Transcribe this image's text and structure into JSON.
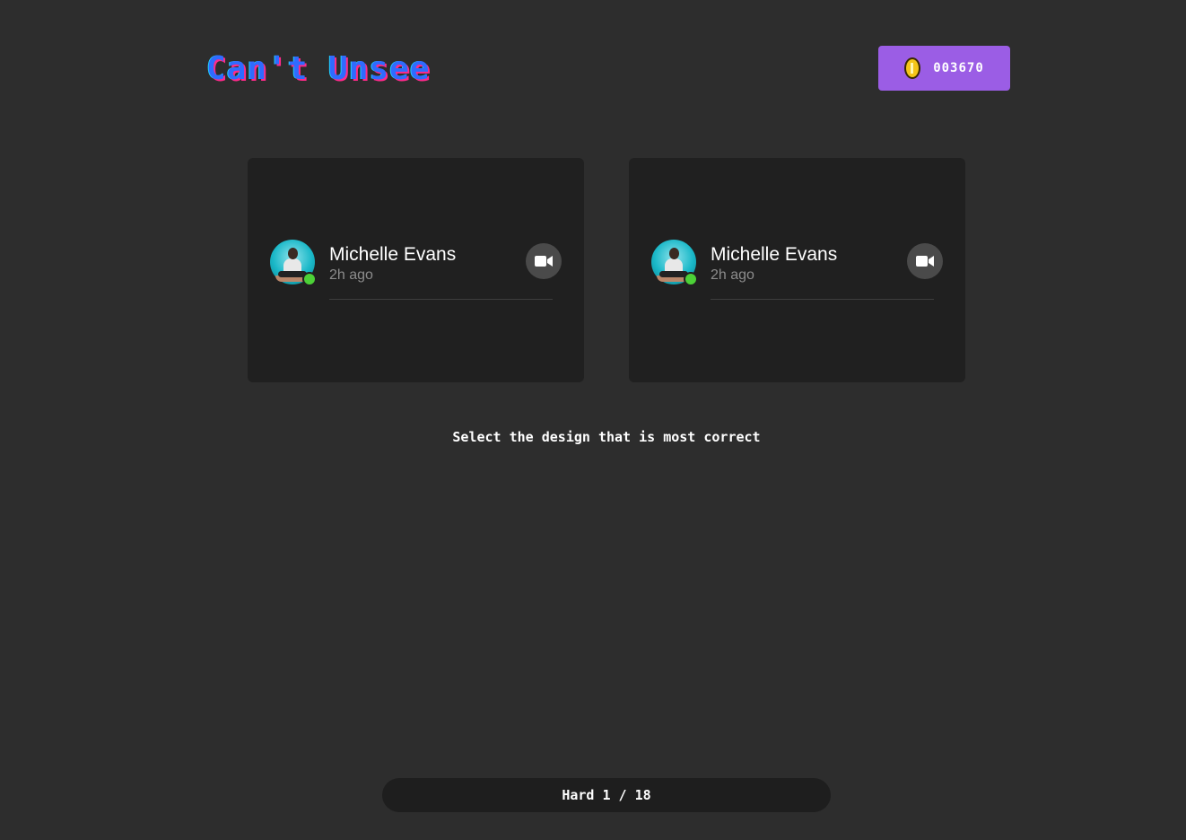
{
  "header": {
    "logo_text": "Can't Unsee",
    "coins": "003670",
    "coin_icon": "coin-icon"
  },
  "options": [
    {
      "name": "Michelle Evans",
      "time": "2h ago",
      "online": true,
      "action_icon": "video-camera-icon"
    },
    {
      "name": "Michelle Evans",
      "time": "2h ago",
      "online": true,
      "action_icon": "video-camera-icon"
    }
  ],
  "prompt": "Select the design that is most correct",
  "progress": {
    "label": "Hard 1 / 18"
  },
  "colors": {
    "background": "#2d2d2d",
    "card": "#202020",
    "coin_button": "#9b5de5",
    "online": "#4cd137",
    "logo": "#2f6bff"
  }
}
